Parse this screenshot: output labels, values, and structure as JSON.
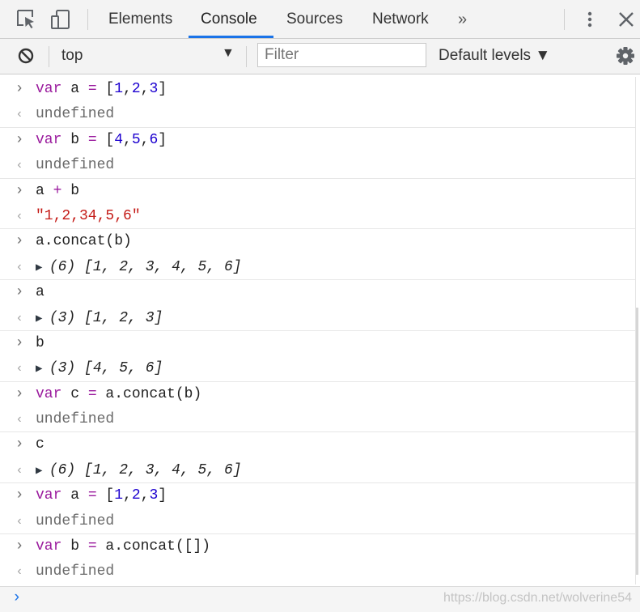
{
  "tabs": {
    "elements": "Elements",
    "console": "Console",
    "sources": "Sources",
    "network": "Network",
    "overflow": "»"
  },
  "toolbar": {
    "context": "top",
    "filter_placeholder": "Filter",
    "levels": "Default levels ▼"
  },
  "console": {
    "entries": [
      {
        "input": [
          [
            "kw",
            "var"
          ],
          [
            "id",
            " a "
          ],
          [
            "kw",
            "="
          ],
          [
            "id",
            " ["
          ],
          [
            "num",
            "1"
          ],
          [
            "id",
            ","
          ],
          [
            "num",
            "2"
          ],
          [
            "id",
            ","
          ],
          [
            "num",
            "3"
          ],
          [
            "id",
            "]"
          ]
        ],
        "result": [
          [
            "plain",
            "undefined"
          ]
        ]
      },
      {
        "input": [
          [
            "kw",
            "var"
          ],
          [
            "id",
            " b "
          ],
          [
            "kw",
            "="
          ],
          [
            "id",
            " ["
          ],
          [
            "num",
            "4"
          ],
          [
            "id",
            ","
          ],
          [
            "num",
            "5"
          ],
          [
            "id",
            ","
          ],
          [
            "num",
            "6"
          ],
          [
            "id",
            "]"
          ]
        ],
        "result": [
          [
            "plain",
            "undefined"
          ]
        ]
      },
      {
        "input": [
          [
            "id",
            "a "
          ],
          [
            "kw",
            "+"
          ],
          [
            "id",
            " b"
          ]
        ],
        "result": [
          [
            "str",
            "\"1,2,34,5,6\""
          ]
        ]
      },
      {
        "input": [
          [
            "id",
            "a.concat(b)"
          ]
        ],
        "result": [
          [
            "tri",
            "▶ "
          ],
          [
            "arr",
            "(6) ["
          ],
          [
            "num",
            "1"
          ],
          [
            "arr",
            ", "
          ],
          [
            "num",
            "2"
          ],
          [
            "arr",
            ", "
          ],
          [
            "num",
            "3"
          ],
          [
            "arr",
            ", "
          ],
          [
            "num",
            "4"
          ],
          [
            "arr",
            ", "
          ],
          [
            "num",
            "5"
          ],
          [
            "arr",
            ", "
          ],
          [
            "num",
            "6"
          ],
          [
            "arr",
            "]"
          ]
        ]
      },
      {
        "input": [
          [
            "id",
            "a"
          ]
        ],
        "result": [
          [
            "tri",
            "▶ "
          ],
          [
            "arr",
            "(3) ["
          ],
          [
            "num",
            "1"
          ],
          [
            "arr",
            ", "
          ],
          [
            "num",
            "2"
          ],
          [
            "arr",
            ", "
          ],
          [
            "num",
            "3"
          ],
          [
            "arr",
            "]"
          ]
        ]
      },
      {
        "input": [
          [
            "id",
            "b"
          ]
        ],
        "result": [
          [
            "tri",
            "▶ "
          ],
          [
            "arr",
            "(3) ["
          ],
          [
            "num",
            "4"
          ],
          [
            "arr",
            ", "
          ],
          [
            "num",
            "5"
          ],
          [
            "arr",
            ", "
          ],
          [
            "num",
            "6"
          ],
          [
            "arr",
            "]"
          ]
        ]
      },
      {
        "input": [
          [
            "kw",
            "var"
          ],
          [
            "id",
            " c "
          ],
          [
            "kw",
            "="
          ],
          [
            "id",
            " a.concat(b)"
          ]
        ],
        "result": [
          [
            "plain",
            "undefined"
          ]
        ]
      },
      {
        "input": [
          [
            "id",
            "c"
          ]
        ],
        "result": [
          [
            "tri",
            "▶ "
          ],
          [
            "arr",
            "(6) ["
          ],
          [
            "num",
            "1"
          ],
          [
            "arr",
            ", "
          ],
          [
            "num",
            "2"
          ],
          [
            "arr",
            ", "
          ],
          [
            "num",
            "3"
          ],
          [
            "arr",
            ", "
          ],
          [
            "num",
            "4"
          ],
          [
            "arr",
            ", "
          ],
          [
            "num",
            "5"
          ],
          [
            "arr",
            ", "
          ],
          [
            "num",
            "6"
          ],
          [
            "arr",
            "]"
          ]
        ]
      },
      {
        "input": [
          [
            "kw",
            "var"
          ],
          [
            "id",
            " a "
          ],
          [
            "kw",
            "="
          ],
          [
            "id",
            " ["
          ],
          [
            "num",
            "1"
          ],
          [
            "id",
            ","
          ],
          [
            "num",
            "2"
          ],
          [
            "id",
            ","
          ],
          [
            "num",
            "3"
          ],
          [
            "id",
            "]"
          ]
        ],
        "result": [
          [
            "plain",
            "undefined"
          ]
        ]
      },
      {
        "input": [
          [
            "kw",
            "var"
          ],
          [
            "id",
            " b "
          ],
          [
            "kw",
            "="
          ],
          [
            "id",
            " a.concat([])"
          ]
        ],
        "result": [
          [
            "plain",
            "undefined"
          ]
        ]
      }
    ]
  },
  "icons": {
    "inspect": "inspect-element-icon",
    "device": "device-toolbar-icon",
    "more": "more-vert-icon",
    "close": "close-icon",
    "clear": "clear-console-icon",
    "settings": "gear-icon"
  },
  "colors": {
    "keyword": "#9a1a9d",
    "number": "#1c00cf",
    "string": "#c41a16",
    "active_tab": "#1a73e8"
  },
  "watermark": "https://blog.csdn.net/wolverine54"
}
